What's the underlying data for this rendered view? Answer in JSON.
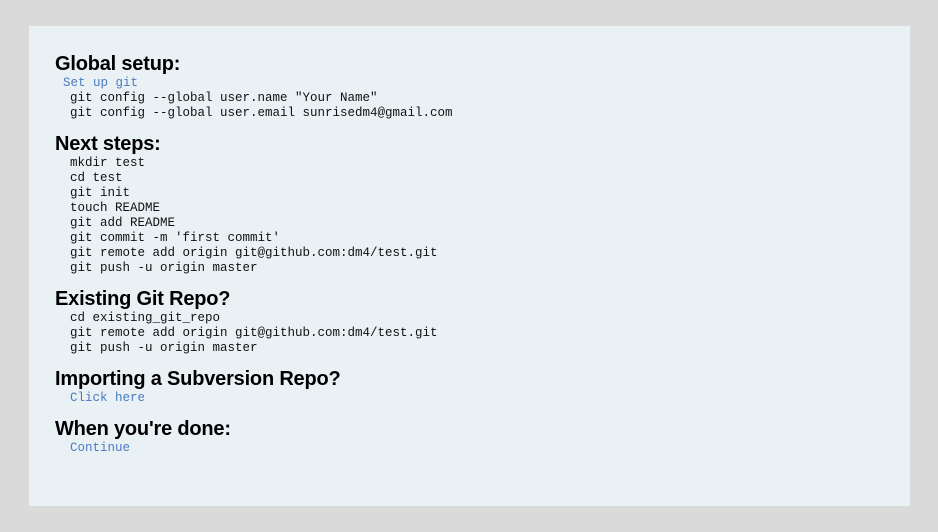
{
  "global_setup": {
    "heading": "Global setup:",
    "link_label": "Set up git",
    "commands": [
      "git config --global user.name \"Your Name\"",
      "git config --global user.email sunrisedm4@gmail.com"
    ]
  },
  "next_steps": {
    "heading": "Next steps:",
    "commands": [
      "mkdir test",
      "cd test",
      "git init",
      "touch README",
      "git add README",
      "git commit -m 'first commit'",
      "git remote add origin git@github.com:dm4/test.git",
      "git push -u origin master"
    ]
  },
  "existing_repo": {
    "heading": "Existing Git Repo?",
    "commands": [
      "cd existing_git_repo",
      "git remote add origin git@github.com:dm4/test.git",
      "git push -u origin master"
    ]
  },
  "subversion": {
    "heading": "Importing a Subversion Repo?",
    "link_label": "Click here"
  },
  "done": {
    "heading": "When you're done:",
    "link_label": "Continue"
  },
  "colors": {
    "background": "#dadada",
    "panel": "#eaf1f5",
    "link": "#4a7bc2"
  }
}
